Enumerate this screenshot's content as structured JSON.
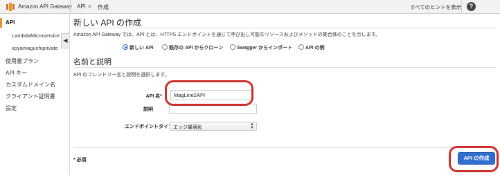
{
  "topbar": {
    "app_name": "Amazon API Gateway",
    "breadcrumb": [
      "API",
      ">",
      "作成"
    ],
    "hint_link": "すべてのヒントを表示",
    "help": "?"
  },
  "sidebar": {
    "items": [
      {
        "label": "API",
        "active": true
      },
      {
        "label": "LambdaMicroservice",
        "sub": true
      },
      {
        "label": "xpyamaguchiprivate",
        "sub": true
      },
      {
        "label": "使用量プラン"
      },
      {
        "label": "API キー"
      },
      {
        "label": "カスタムドメイン名"
      },
      {
        "label": "クライアント証明書"
      },
      {
        "label": "設定"
      }
    ],
    "collapse_glyph": "◀"
  },
  "main": {
    "title": "新しい API の作成",
    "description": "Amazon API Gateway では、API とは、HTTPS エンドポイントを通じて呼び出し可能なリソースおよびメソッドの集合体のことを示します。",
    "radio_options": [
      {
        "label": "新しい API",
        "selected": true
      },
      {
        "label": "既存の API からクローン",
        "selected": false
      },
      {
        "label": "Swagger からインポート",
        "selected": false
      },
      {
        "label": "API の例",
        "selected": false
      }
    ],
    "section_title": "名前と説明",
    "section_description": "API のフレンドリー名と説明を選択します。",
    "fields": {
      "api_name_label": "API 名*",
      "api_name_value": "MagLine2API",
      "description_label": "説明",
      "description_value": "",
      "endpoint_label": "エンドポイントタイプ",
      "endpoint_value": "エッジ最適化"
    },
    "required_note": "* 必須",
    "create_button": "API の作成"
  },
  "colors": {
    "accent_orange": "#e7912b",
    "button_blue": "#2f6fcf",
    "highlight_red": "#c9302c"
  }
}
